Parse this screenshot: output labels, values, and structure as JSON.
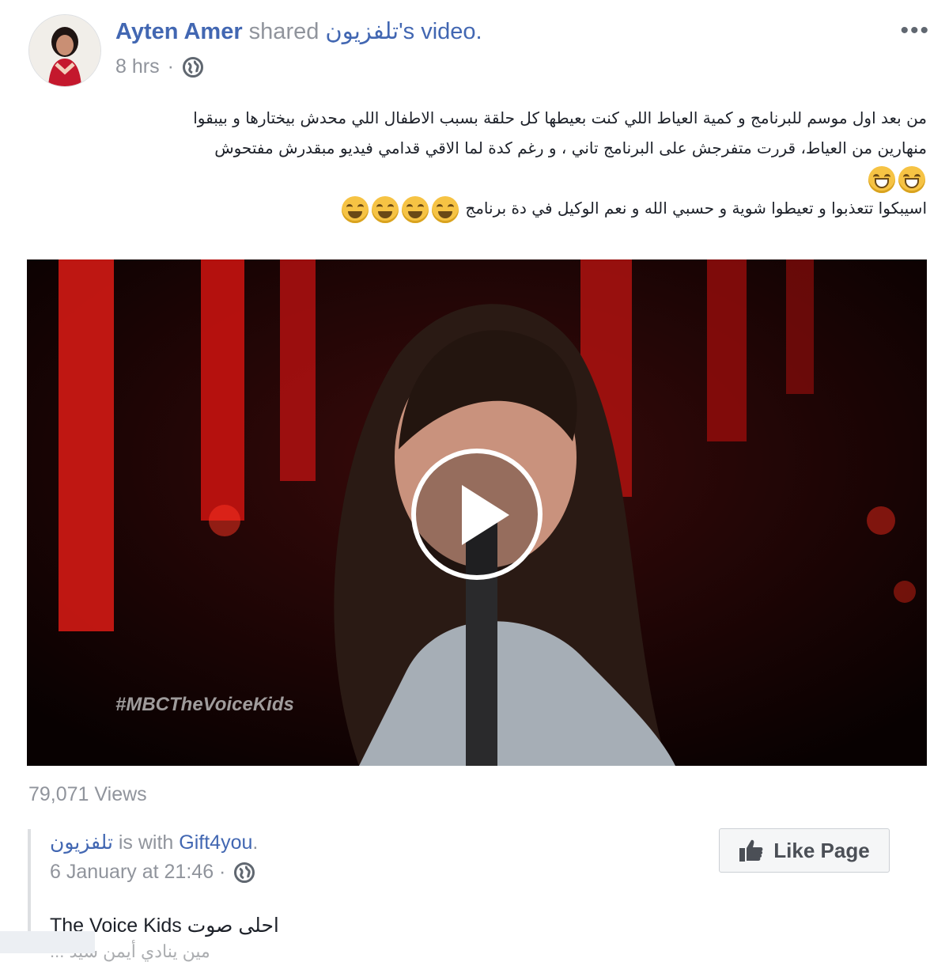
{
  "post": {
    "author": "Ayten Amer",
    "shared_word": " shared ",
    "page_name": "تلفزيون",
    "suffix": "'s video.",
    "time": "8 hrs",
    "more": "•••",
    "text_line1": "من بعد اول موسم للبرنامج و كمية العياط اللي كنت بعيطها كل حلقة بسبب الاطفال اللي محدش بيختارها و بيبقوا",
    "text_line2": "منهارين من العياط، قررت متفرجش على البرنامج تاني ، و رغم كدة لما الاقي قدامي فيديو مبقدرش مفتحوش",
    "text_line4": "اسيبكوا تتعذبوا و تعيطوا شوية و حسبي الله و نعم الوكيل في دة برنامج"
  },
  "video": {
    "watermark": "#MBCTheVoiceKids",
    "views": "79,071 Views"
  },
  "original": {
    "page": "تلفزيون",
    "is_with": " is with ",
    "tagged": "Gift4you",
    "period": ".",
    "time": "6 January at 21:46 ·",
    "text": "The Voice Kids احلى صوت",
    "text2": "... مين ينادي أيمن شيد"
  },
  "like_page": {
    "label": "Like Page"
  },
  "colors": {
    "link": "#4267b2",
    "meta": "#90949c",
    "text": "#1d2129"
  }
}
